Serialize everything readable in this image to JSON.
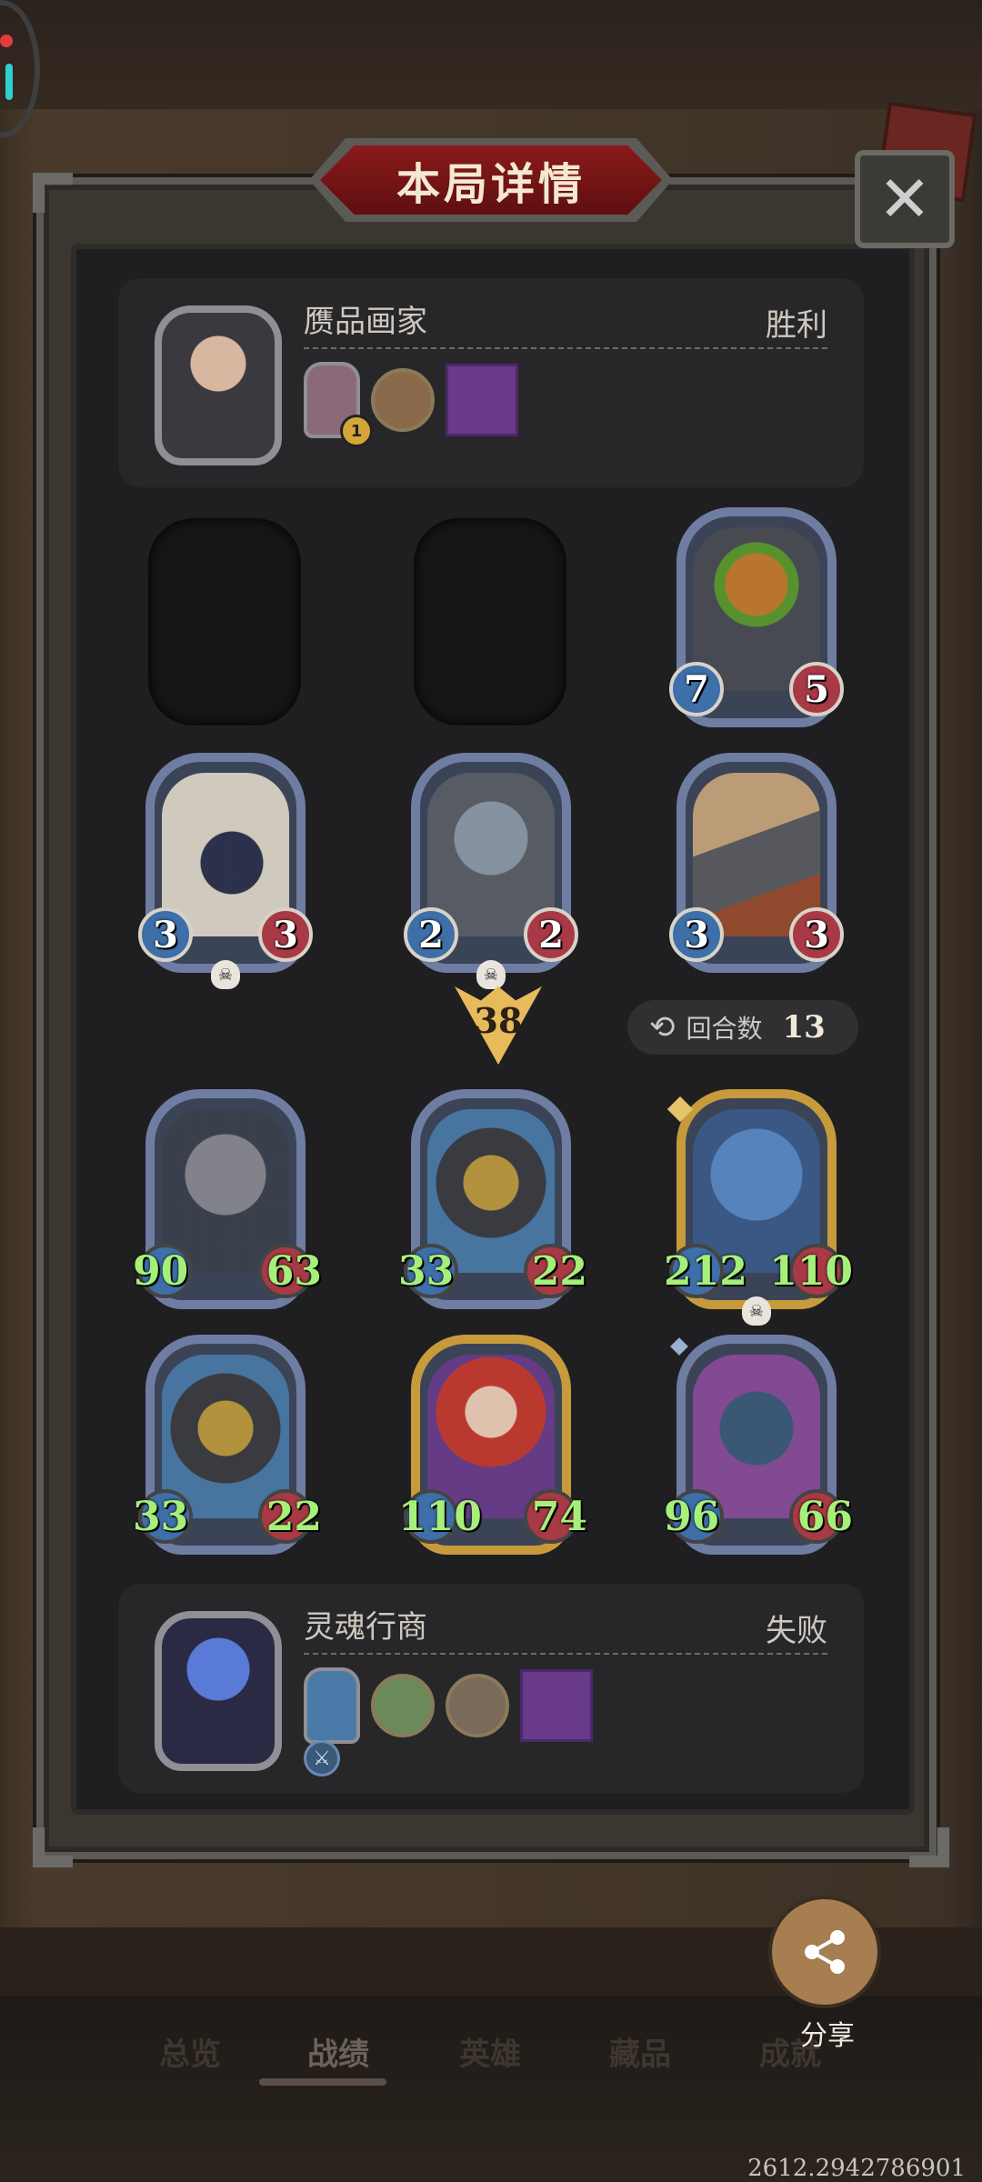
{
  "header": {
    "title": "本局详情",
    "close_icon": "close-icon"
  },
  "opponent": {
    "name": "赝品画家",
    "result": "胜利",
    "items": [
      "painting-frame-icon",
      "coin-portrait-icon",
      "goblin-card-icon"
    ],
    "item_level": "1"
  },
  "player": {
    "name": "灵魂行商",
    "result": "失败",
    "items": [
      "blue-spirit-frame-icon",
      "zombie-coin-icon",
      "portrait-coin-icon",
      "goblin-card-icon"
    ],
    "sub_icon": "sword-shield-icon"
  },
  "opponent_board": [
    {
      "atk": "7",
      "hp": "5",
      "frame": "blue",
      "dead": false
    },
    {
      "atk": "3",
      "hp": "3",
      "frame": "blue",
      "dead": true
    },
    {
      "atk": "2",
      "hp": "2",
      "frame": "blue",
      "dead": true
    },
    {
      "atk": "3",
      "hp": "3",
      "frame": "blue",
      "dead": false
    }
  ],
  "damage": {
    "value": "38"
  },
  "turns": {
    "label": "回合数",
    "value": "13"
  },
  "player_board": [
    {
      "atk": "90",
      "hp": "63",
      "frame": "blue"
    },
    {
      "atk": "33",
      "hp": "22",
      "frame": "blue"
    },
    {
      "atk": "212",
      "hp": "110",
      "frame": "gold",
      "dead": true
    },
    {
      "atk": "33",
      "hp": "22",
      "frame": "blue"
    },
    {
      "atk": "110",
      "hp": "74",
      "frame": "gold"
    },
    {
      "atk": "96",
      "hp": "66",
      "frame": "blue"
    }
  ],
  "share": {
    "label": "分享",
    "icon": "share-icon"
  },
  "tabs": [
    {
      "label": "总览",
      "active": false
    },
    {
      "label": "战绩",
      "active": true
    },
    {
      "label": "英雄",
      "active": false
    },
    {
      "label": "藏品",
      "active": false
    },
    {
      "label": "成就",
      "active": false
    }
  ],
  "footer": {
    "id": "2612.2942786901"
  },
  "colors": {
    "stat_attack": "#3e6fa8",
    "stat_health": "#a83a46",
    "buffed_stat_text": "#a6f07a",
    "title_banner": "#8a1a1a",
    "damage_arrow": "#e7bb5c"
  }
}
